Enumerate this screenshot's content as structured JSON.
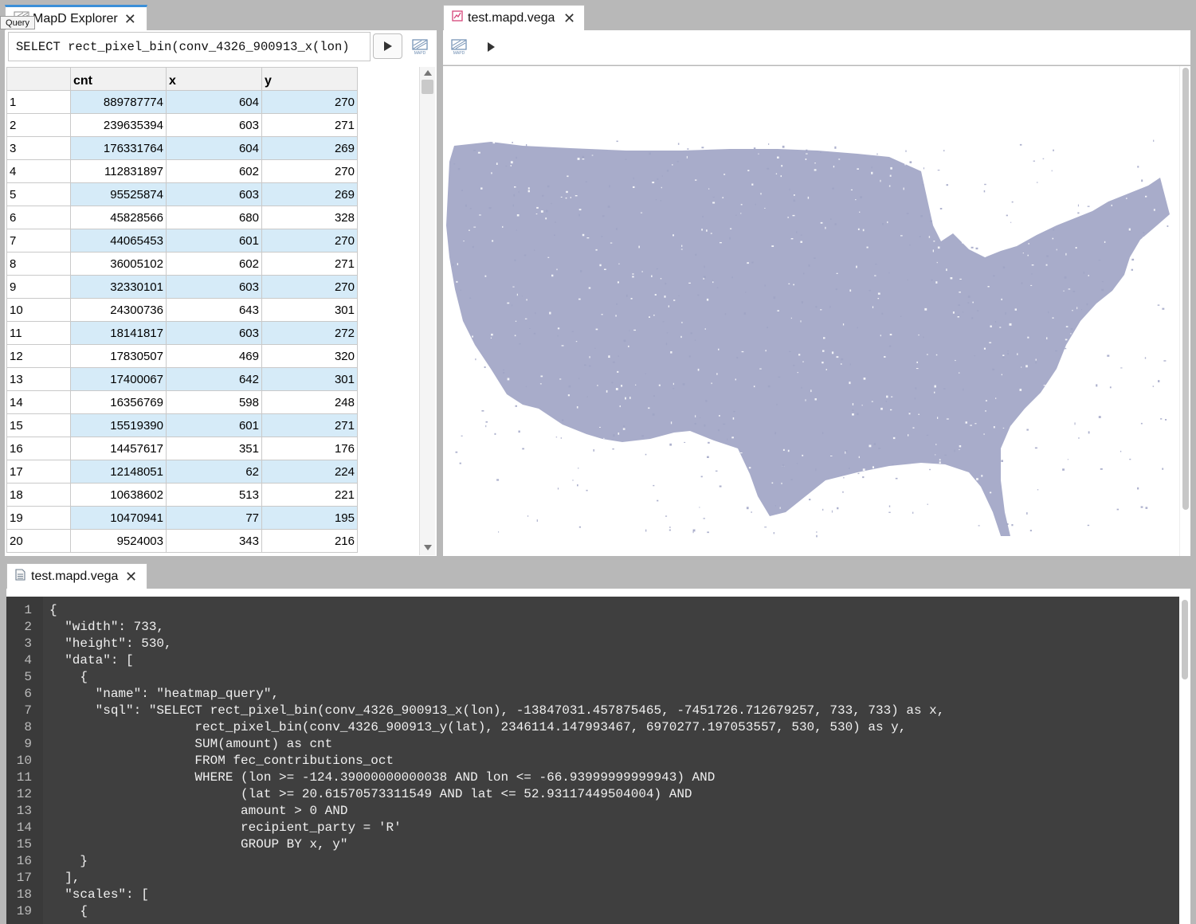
{
  "explorer_tab": {
    "title": "MapD Explorer",
    "tooltip": "Query"
  },
  "query": {
    "text": "SELECT rect_pixel_bin(conv_4326_900913_x(lon)"
  },
  "table": {
    "columns": [
      "",
      "cnt",
      "x",
      "y"
    ],
    "rows": [
      [
        "1",
        "889787774",
        "604",
        "270"
      ],
      [
        "2",
        "239635394",
        "603",
        "271"
      ],
      [
        "3",
        "176331764",
        "604",
        "269"
      ],
      [
        "4",
        "112831897",
        "602",
        "270"
      ],
      [
        "5",
        "95525874",
        "603",
        "269"
      ],
      [
        "6",
        "45828566",
        "680",
        "328"
      ],
      [
        "7",
        "44065453",
        "601",
        "270"
      ],
      [
        "8",
        "36005102",
        "602",
        "271"
      ],
      [
        "9",
        "32330101",
        "603",
        "270"
      ],
      [
        "10",
        "24300736",
        "643",
        "301"
      ],
      [
        "11",
        "18141817",
        "603",
        "272"
      ],
      [
        "12",
        "17830507",
        "469",
        "320"
      ],
      [
        "13",
        "17400067",
        "642",
        "301"
      ],
      [
        "14",
        "16356769",
        "598",
        "248"
      ],
      [
        "15",
        "15519390",
        "601",
        "271"
      ],
      [
        "16",
        "14457617",
        "351",
        "176"
      ],
      [
        "17",
        "12148051",
        "62",
        "224"
      ],
      [
        "18",
        "10638602",
        "513",
        "221"
      ],
      [
        "19",
        "10470941",
        "77",
        "195"
      ],
      [
        "20",
        "9524003",
        "343",
        "216"
      ]
    ]
  },
  "viz_tab": {
    "title": "test.mapd.vega"
  },
  "editor_tab": {
    "title": "test.mapd.vega"
  },
  "editor": {
    "lines": [
      "{",
      "  \"width\": 733,",
      "  \"height\": 530,",
      "  \"data\": [",
      "    {",
      "      \"name\": \"heatmap_query\",",
      "      \"sql\": \"SELECT rect_pixel_bin(conv_4326_900913_x(lon), -13847031.457875465, -7451726.712679257, 733, 733) as x,",
      "                   rect_pixel_bin(conv_4326_900913_y(lat), 2346114.147993467, 6970277.197053557, 530, 530) as y,",
      "                   SUM(amount) as cnt",
      "                   FROM fec_contributions_oct",
      "                   WHERE (lon >= -124.39000000000038 AND lon <= -66.93999999999943) AND",
      "                         (lat >= 20.61570573311549 AND lat <= 52.93117449504004) AND",
      "                         amount > 0 AND",
      "                         recipient_party = 'R'",
      "                         GROUP BY x, y\"",
      "    }",
      "  ],",
      "  \"scales\": [",
      "    {"
    ]
  },
  "colors": {
    "map_fill": "#9fa3c4",
    "row_highlight": "#d6ebf8",
    "editor_bg": "#3f3f3f"
  }
}
